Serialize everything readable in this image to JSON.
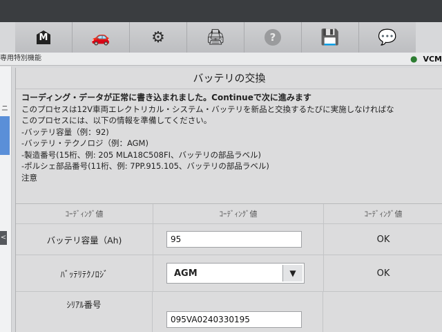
{
  "toolbar": {
    "buttons": [
      {
        "name": "home-icon",
        "glyph": "M"
      },
      {
        "name": "vehicle-swap-icon",
        "glyph": "🚗"
      },
      {
        "name": "settings-icon",
        "glyph": "⚙"
      },
      {
        "name": "print-icon",
        "glyph": "🖨"
      },
      {
        "name": "help-icon",
        "glyph": "?"
      },
      {
        "name": "save-icon",
        "glyph": "💾"
      },
      {
        "name": "message-icon",
        "glyph": "💬"
      }
    ]
  },
  "breadcrumb": {
    "text": "専用特別機能"
  },
  "status": {
    "vcm": "VCM"
  },
  "left_tab": {
    "text": "ニ"
  },
  "panel": {
    "title": "バッテリの交換",
    "lines": [
      "コーディング・データが正常に書き込まれました。Continueで次に進みます",
      "このプロセスは12V車両エレクトリカル・システム・バッテリを新品と交換するたびに実施しなければな",
      "このプロセスには、以下の情報を準備してください。",
      "-バッテリ容量（例：92)",
      "-バッテリ・テクノロジ（例：AGM)",
      "-製造番号(15桁、例: 205 MLA18C508FI、バッテリの部品ラベル)",
      "-ポルシェ部品番号(11桁、例: 7PP.915.105、バッテリの部品ラベル)",
      "注意"
    ]
  },
  "table": {
    "headers": [
      "ｺｰﾃﾞｨﾝｸﾞ値",
      "ｺｰﾃﾞｨﾝｸﾞ値",
      "ｺｰﾃﾞｨﾝｸﾞ値"
    ],
    "rows": [
      {
        "label": "バッテリ容量（Ah)",
        "value": "95",
        "status": "OK"
      },
      {
        "label": "ﾊﾞｯﾃﾘﾃｸﾉﾛｼﾞ",
        "value": "AGM",
        "status": "OK"
      },
      {
        "label": "ｼﾘｱﾙ番号",
        "value": "095VA0240330195",
        "status": ""
      }
    ]
  }
}
